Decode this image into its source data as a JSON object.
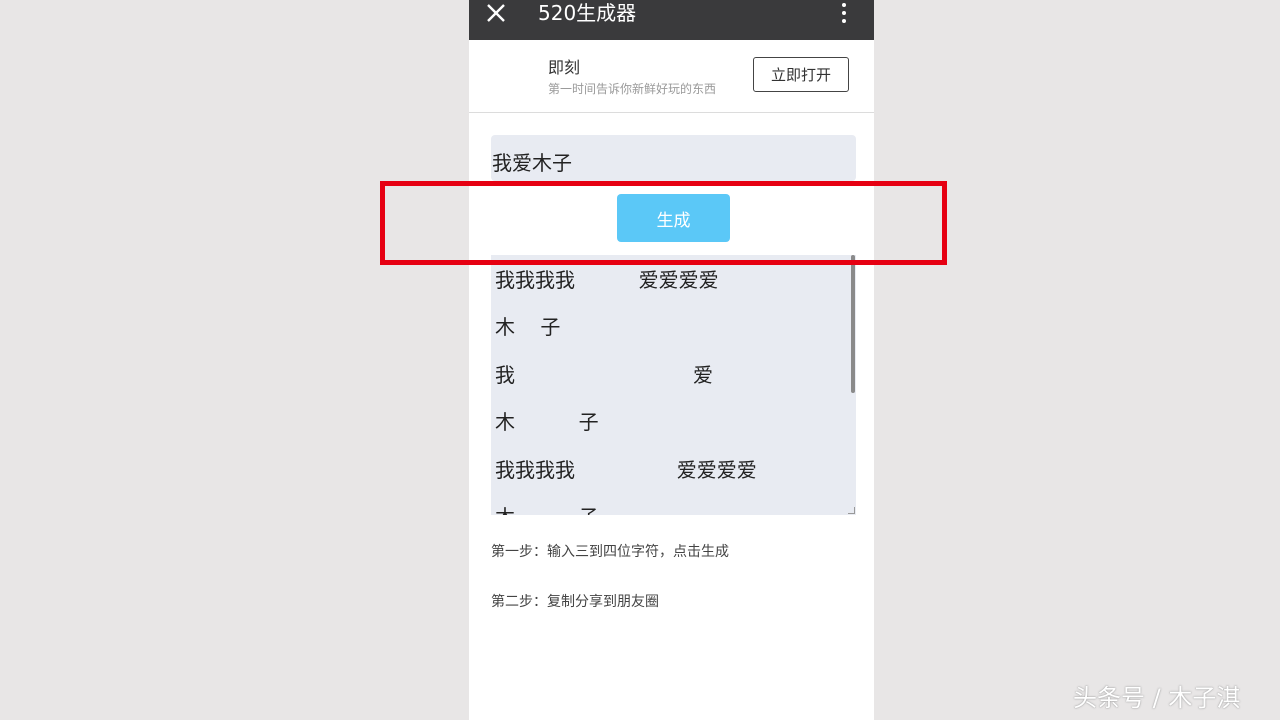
{
  "app": {
    "title": "520生成器",
    "close_icon": "close-icon",
    "more_icon": "more-vertical-icon"
  },
  "banner": {
    "name": "即刻",
    "description": "第一时间告诉你新鲜好玩的东西",
    "open_label": "立即打开"
  },
  "input": {
    "value": "我爱木子"
  },
  "generate": {
    "label": "生成",
    "color": "#5bc8f7"
  },
  "output": {
    "lines": [
      "我我我我          爱爱爱爱",
      "木    子",
      "我                            爱",
      "木          子",
      "我我我我                爱爱爱爱",
      "木          子"
    ]
  },
  "steps": {
    "step1": "第一步：输入三到四位字符，点击生成",
    "step2": "第二步：复制分享到朋友圈"
  },
  "annotation": {
    "highlight_color": "#e60012"
  },
  "watermark": {
    "text": "头条号 / 木子淇"
  }
}
